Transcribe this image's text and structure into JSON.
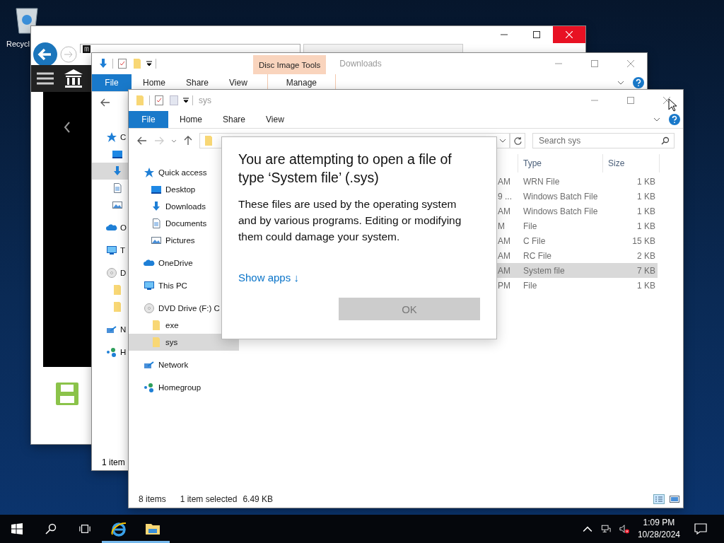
{
  "desktop": {
    "icons": [
      {
        "label": "Recycl"
      }
    ]
  },
  "back": {
    "title": "Downloads",
    "context_group": "Disc Image Tools",
    "file_tab": "File",
    "tabs": [
      "Home",
      "Share",
      "View"
    ],
    "context_tab": "Manage",
    "status": "1 item",
    "nav": [
      {
        "kind": "star",
        "label": "C",
        "selected": false,
        "children": [
          {
            "kind": "desktop",
            "selected": false
          },
          {
            "kind": "downloads",
            "selected": true
          },
          {
            "kind": "documents",
            "selected": false
          },
          {
            "kind": "pictures",
            "selected": false
          }
        ]
      },
      {
        "kind": "onedrive",
        "label": "O",
        "selected": false
      },
      {
        "kind": "pc",
        "label": "T",
        "selected": false
      },
      {
        "kind": "dvd",
        "label": "D",
        "selected": false,
        "children": [
          {
            "kind": "folder",
            "selected": false
          },
          {
            "kind": "folder",
            "selected": false
          }
        ]
      },
      {
        "kind": "network",
        "label": "N",
        "selected": false
      },
      {
        "kind": "homegroup",
        "label": "H",
        "selected": false
      }
    ]
  },
  "front": {
    "title": "sys",
    "file_tab": "File",
    "tabs": [
      "Home",
      "Share",
      "View"
    ],
    "search": {
      "placeholder": "Search sys"
    },
    "nav": [
      {
        "kind": "star",
        "label": "Quick access",
        "selected": false,
        "children": [
          {
            "kind": "desktop",
            "label": "Desktop",
            "selected": false
          },
          {
            "kind": "downloads",
            "label": "Downloads",
            "selected": false
          },
          {
            "kind": "documents",
            "label": "Documents",
            "selected": false
          },
          {
            "kind": "pictures",
            "label": "Pictures",
            "selected": false
          }
        ]
      },
      {
        "kind": "onedrive",
        "label": "OneDrive",
        "selected": false
      },
      {
        "kind": "pc",
        "label": "This PC",
        "selected": false
      },
      {
        "kind": "dvd",
        "label": "DVD Drive (F:) C",
        "selected": false,
        "children": [
          {
            "kind": "folder",
            "label": "exe",
            "selected": false
          },
          {
            "kind": "folder",
            "label": "sys",
            "selected": true
          }
        ]
      },
      {
        "kind": "network",
        "label": "Network",
        "selected": false
      },
      {
        "kind": "homegroup",
        "label": "Homegroup",
        "selected": false
      }
    ],
    "columns": [
      "Type",
      "Size"
    ],
    "rows": [
      {
        "column_1": "AM",
        "type": "WRN File",
        "size": "1 KB",
        "selected": false
      },
      {
        "column_1": "9 ...",
        "type": "Windows Batch File",
        "size": "1 KB",
        "selected": false
      },
      {
        "column_1": "AM",
        "type": "Windows Batch File",
        "size": "1 KB",
        "selected": false
      },
      {
        "column_1": "M",
        "type": "File",
        "size": "1 KB",
        "selected": false
      },
      {
        "column_1": "AM",
        "type": "C File",
        "size": "15 KB",
        "selected": false
      },
      {
        "column_1": "AM",
        "type": "RC File",
        "size": "2 KB",
        "selected": false
      },
      {
        "column_1": "AM",
        "type": "System file",
        "size": "7 KB",
        "selected": true
      },
      {
        "column_1": "PM",
        "type": "File",
        "size": "1 KB",
        "selected": false
      }
    ],
    "status": {
      "count": "8 items",
      "selection": "1 item selected",
      "size": "6.49 KB"
    }
  },
  "dialog": {
    "title": "You are attempting to open a file of type ‘System file’ (.sys)",
    "body": "These files are used by the operating system and by various programs. Editing or modifying them could damage your system.",
    "link": "Show apps ↓",
    "button": {
      "label": "OK",
      "disabled": true
    }
  },
  "taskbar": {
    "apps": [
      {
        "kind": "ie",
        "running": true
      },
      {
        "kind": "explorer",
        "running": true
      }
    ],
    "volume_muted": true,
    "time": "1:09 PM",
    "date": "10/28/2024"
  }
}
